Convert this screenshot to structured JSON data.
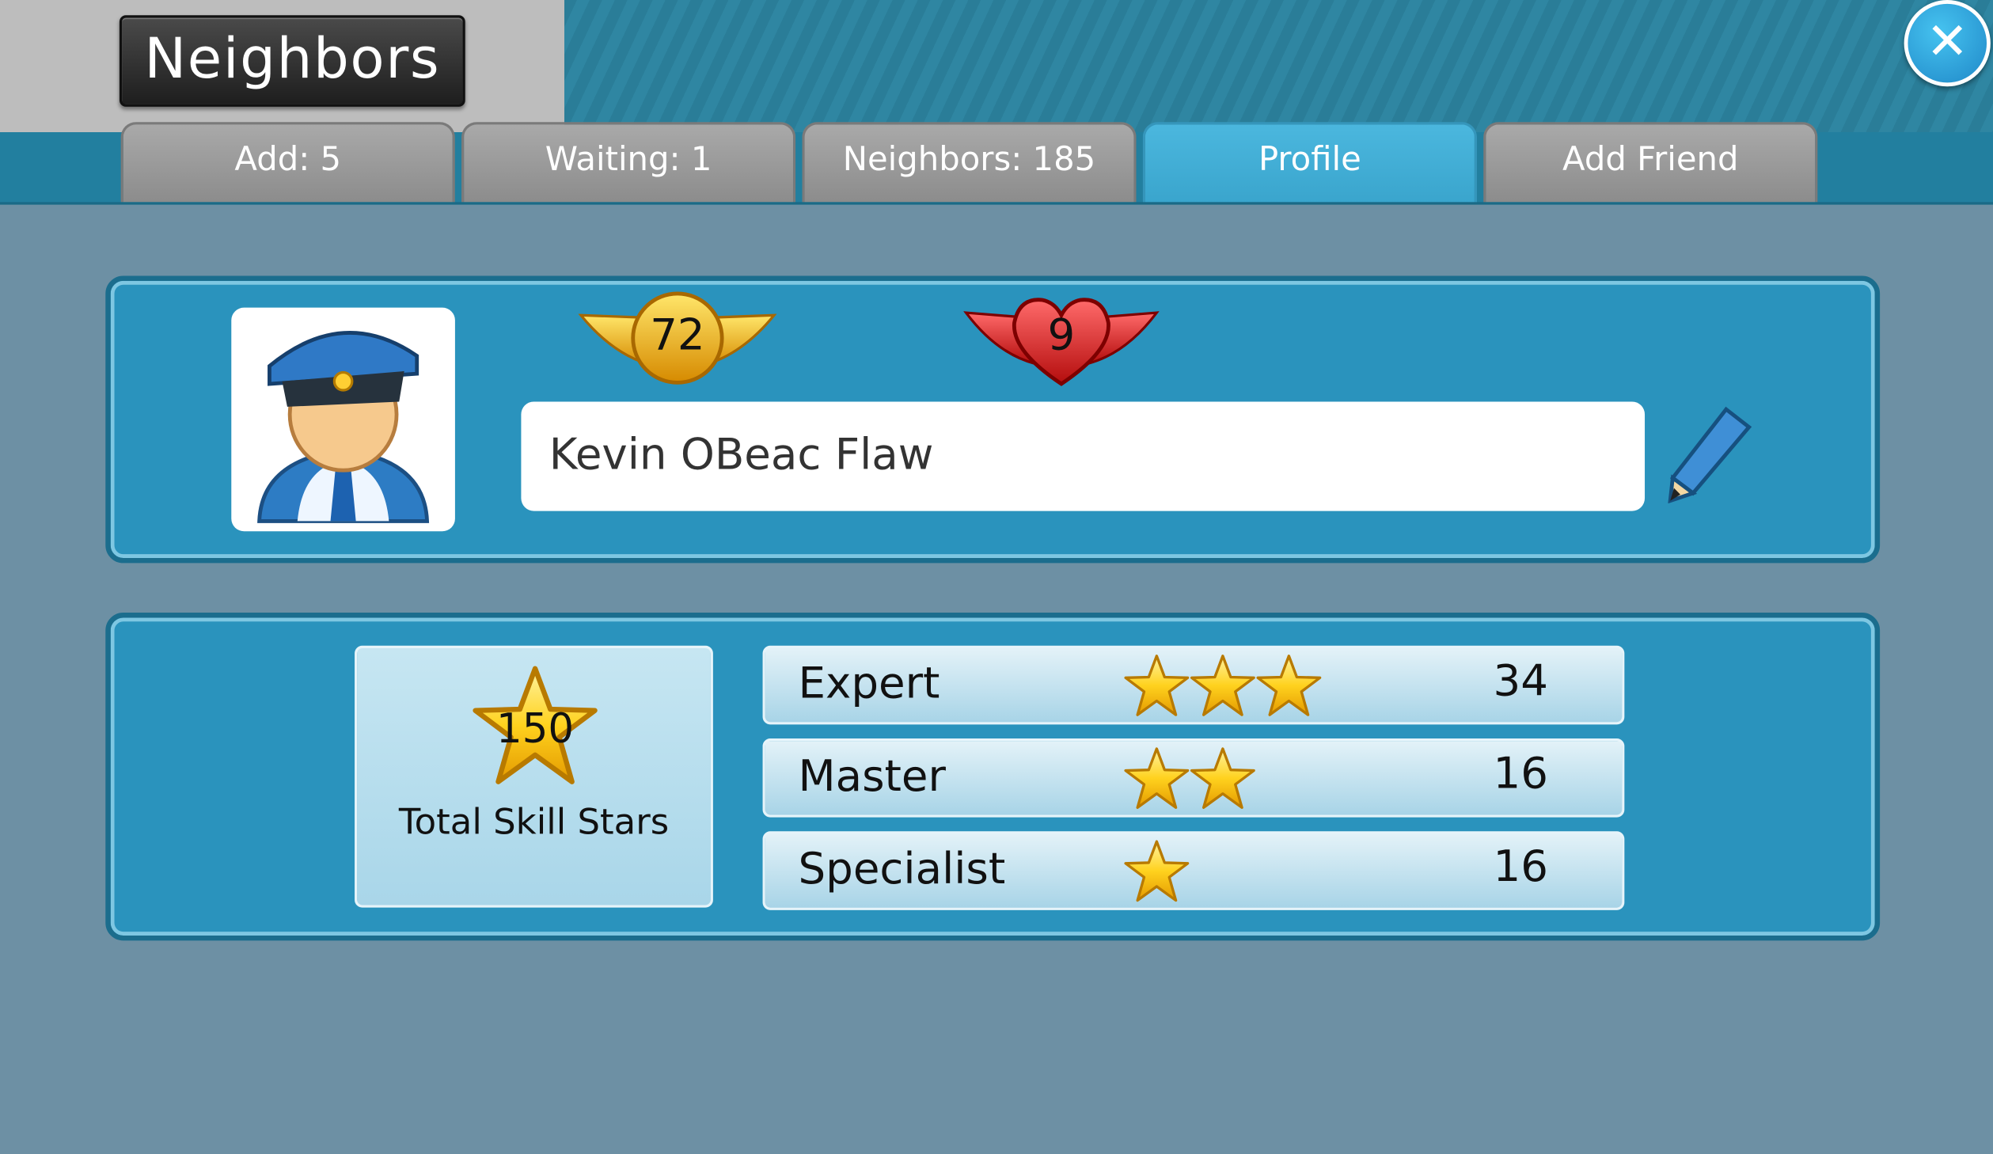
{
  "window": {
    "title": "Neighbors",
    "close_icon": "close-icon"
  },
  "tabs": [
    {
      "label": "Add: 5"
    },
    {
      "label": "Waiting: 1"
    },
    {
      "label": "Neighbors: 185"
    },
    {
      "label": "Profile",
      "active": true
    },
    {
      "label": "Add Friend"
    }
  ],
  "profile": {
    "avatar_icon": "pilot-avatar-icon",
    "level_badge": "72",
    "hearts_badge": "9",
    "name": "Kevin OBeac Flaw",
    "edit_icon": "pencil-icon"
  },
  "skills": {
    "total": "150",
    "total_label": "Total Skill Stars",
    "rows": [
      {
        "label": "Expert",
        "stars": 3,
        "count": "34"
      },
      {
        "label": "Master",
        "stars": 2,
        "count": "16"
      },
      {
        "label": "Specialist",
        "stars": 1,
        "count": "16"
      }
    ]
  },
  "colors": {
    "panel": "#2a93bd",
    "background": "#6d90a4",
    "tab_active": "#42b0d8",
    "tab_inactive": "#9b9b9b"
  }
}
